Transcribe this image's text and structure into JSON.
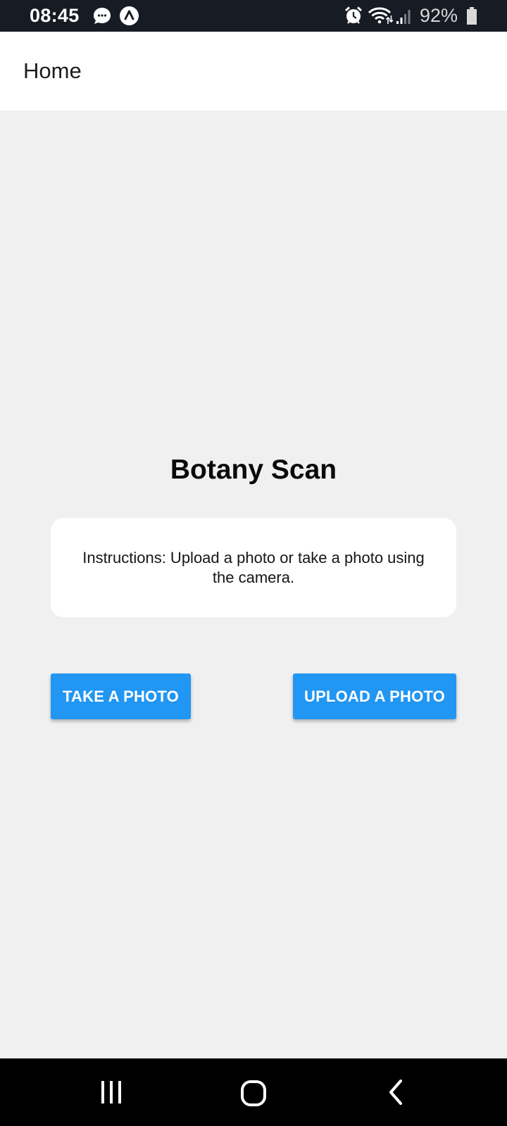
{
  "status_bar": {
    "time": "08:45",
    "battery": "92%",
    "icons": [
      "messages-icon",
      "app-notification-icon",
      "alarm-icon",
      "wifi-icon",
      "signal-icon",
      "battery-icon"
    ]
  },
  "app_bar": {
    "title": "Home"
  },
  "main": {
    "title": "Botany Scan",
    "instructions": "Instructions: Upload a photo or take a photo using the camera.",
    "take_photo_label": "TAKE A PHOTO",
    "upload_photo_label": "UPLOAD A PHOTO"
  },
  "nav_bar": {
    "icons": [
      "recent-apps-icon",
      "home-icon",
      "back-icon"
    ]
  },
  "colors": {
    "status_bar": "#161b24",
    "app_bar": "#ffffff",
    "background": "#f0f0f0",
    "primary_button": "#2196f3",
    "nav_bar": "#000000"
  }
}
